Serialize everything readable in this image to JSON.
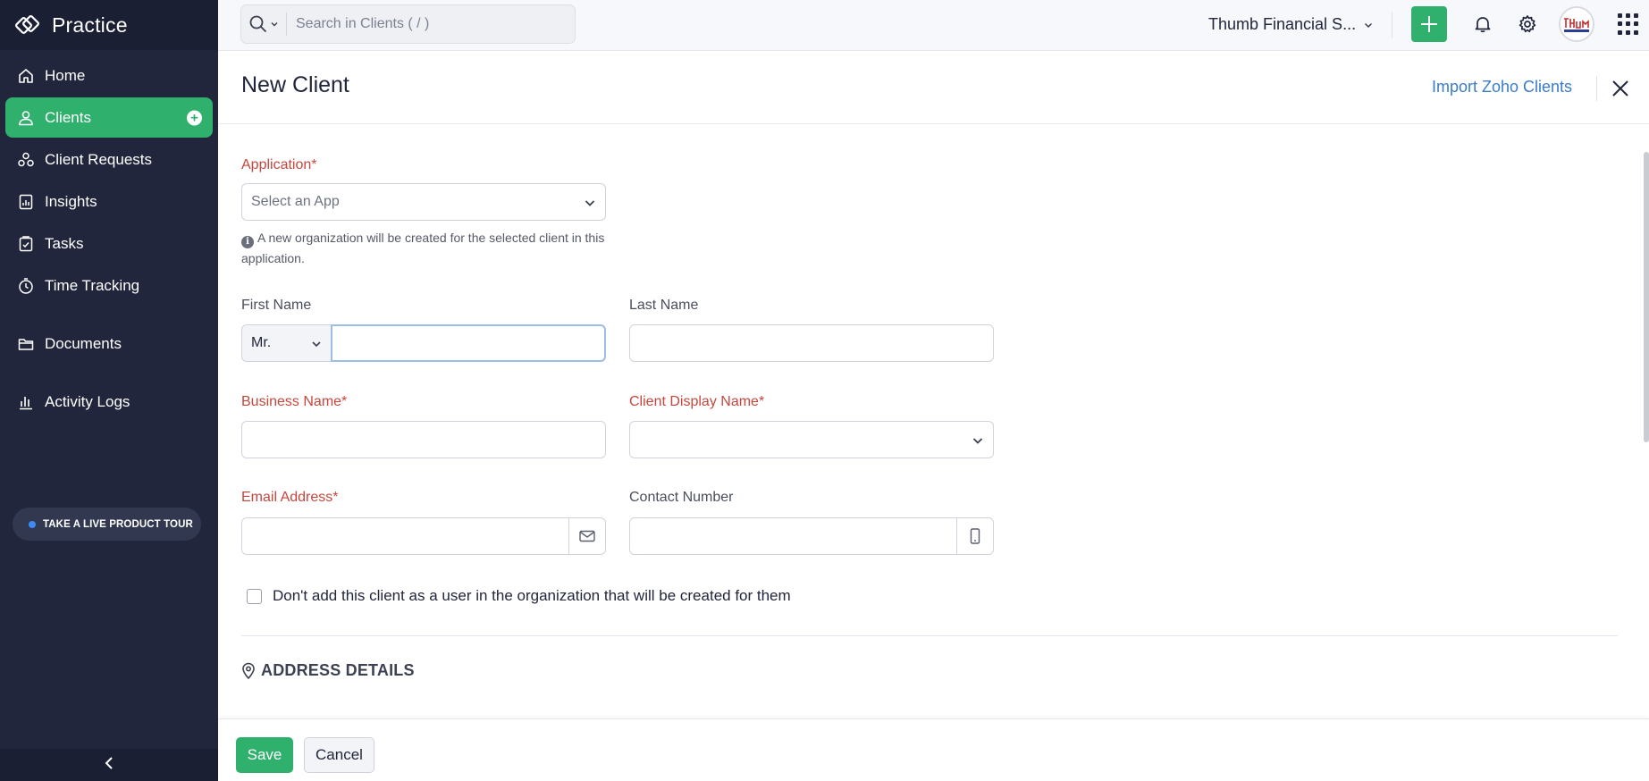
{
  "app": {
    "name": "Practice"
  },
  "sidebar": {
    "items": [
      {
        "label": "Home",
        "icon": "home-icon"
      },
      {
        "label": "Clients",
        "icon": "user-icon",
        "active": true
      },
      {
        "label": "Client Requests",
        "icon": "requests-icon"
      },
      {
        "label": "Insights",
        "icon": "insights-icon"
      },
      {
        "label": "Tasks",
        "icon": "tasks-icon"
      },
      {
        "label": "Time Tracking",
        "icon": "timer-icon"
      },
      {
        "label": "Documents",
        "icon": "folder-icon"
      },
      {
        "label": "Activity Logs",
        "icon": "bar-chart-icon"
      }
    ],
    "tour_label": "TAKE A LIVE PRODUCT TOUR"
  },
  "topbar": {
    "search_placeholder": "Search in Clients ( / )",
    "org_name": "Thumb Financial S...",
    "avatar_text": "Thumb"
  },
  "page": {
    "title": "New Client",
    "import_link": "Import Zoho Clients"
  },
  "form": {
    "application_label": "Application*",
    "application_placeholder": "Select an App",
    "application_hint": "A new organization will be created for the selected client in this application.",
    "first_name_label": "First Name",
    "salutation_value": "Mr.",
    "first_name_value": "",
    "last_name_label": "Last Name",
    "last_name_value": "",
    "business_name_label": "Business Name*",
    "business_name_value": "",
    "display_name_label": "Client Display Name*",
    "display_name_value": "",
    "email_label": "Email Address*",
    "email_value": "",
    "contact_label": "Contact Number",
    "contact_value": "",
    "checkbox_label": "Don't add this client as a user in the organization that will be created for them",
    "address_section": "ADDRESS DETAILS"
  },
  "footer": {
    "save_label": "Save",
    "cancel_label": "Cancel"
  },
  "colors": {
    "sidebar_bg": "#21263c",
    "accent_green": "#2fb06c",
    "required_red": "#c5473d",
    "link_blue": "#3a7cc9"
  }
}
